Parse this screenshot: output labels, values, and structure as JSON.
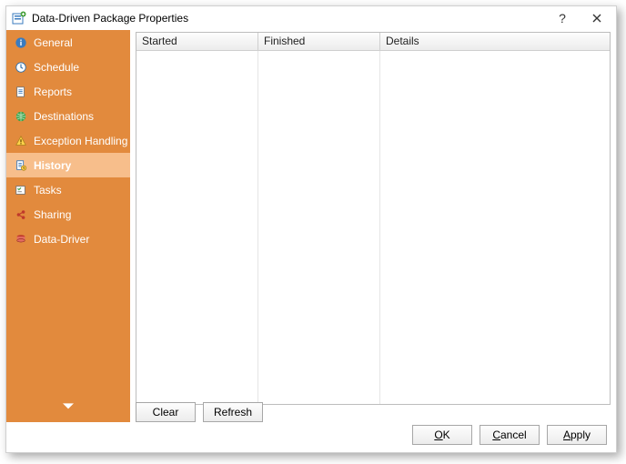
{
  "titlebar": {
    "title": "Data-Driven Package Properties",
    "help": "?"
  },
  "sidebar": {
    "items": [
      {
        "label": "General"
      },
      {
        "label": "Schedule"
      },
      {
        "label": "Reports"
      },
      {
        "label": "Destinations"
      },
      {
        "label": "Exception Handling"
      },
      {
        "label": "History"
      },
      {
        "label": "Tasks"
      },
      {
        "label": "Sharing"
      },
      {
        "label": "Data-Driver"
      }
    ],
    "selected_index": 5
  },
  "table": {
    "columns": [
      "Started",
      "Finished",
      "Details"
    ],
    "rows": []
  },
  "buttons": {
    "clear": "Clear",
    "refresh": "Refresh",
    "ok_u": "O",
    "ok_r": "K",
    "cancel_u": "C",
    "cancel_r": "ancel",
    "apply_u": "A",
    "apply_r": "pply"
  }
}
